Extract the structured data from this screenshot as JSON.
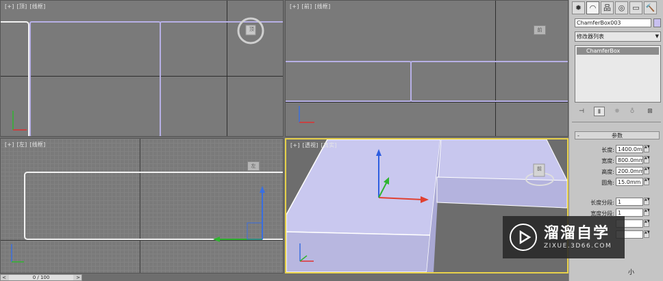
{
  "viewports": {
    "top": {
      "labels": [
        "[+]",
        "[顶]",
        "[线框]"
      ]
    },
    "front": {
      "labels": [
        "[+]",
        "[前]",
        "[线框]"
      ]
    },
    "left": {
      "labels": [
        "[+]",
        "[左]",
        "[线框]"
      ]
    },
    "perspective": {
      "labels": [
        "[+]",
        "[透视]",
        "[真实]"
      ]
    },
    "viewcube": {
      "top_face": "顶",
      "front_face": "前",
      "left_face": "左",
      "persp_face": "前"
    }
  },
  "command_panel": {
    "tabs": [
      {
        "icon": "create-icon",
        "glyph": "✹"
      },
      {
        "icon": "modify-icon",
        "glyph": "◠"
      },
      {
        "icon": "hierarchy-icon",
        "glyph": "品"
      },
      {
        "icon": "motion-icon",
        "glyph": "◎"
      },
      {
        "icon": "display-icon",
        "glyph": "▭"
      },
      {
        "icon": "utilities-icon",
        "glyph": "🔨"
      }
    ],
    "object_name": "ChamferBox003",
    "object_color": "#c8c0f0",
    "modifier_list": "修改器列表",
    "stack_item": "ChamferBox",
    "params_header": "参数",
    "params": [
      {
        "label": "长度:",
        "value": "1400.0mm"
      },
      {
        "label": "宽度:",
        "value": "800.0mm"
      },
      {
        "label": "高度:",
        "value": "200.0mm"
      },
      {
        "label": "圆角:",
        "value": "15.0mm"
      }
    ],
    "segments": [
      {
        "label": "长度分段:",
        "value": "1"
      },
      {
        "label": "宽度分段:",
        "value": "1"
      },
      {
        "label": "",
        "value": ""
      },
      {
        "label": "",
        "value": ""
      }
    ],
    "bottom_text": "小"
  },
  "time_slider": {
    "value": "0 / 100",
    "left": "<",
    "right": ">"
  },
  "watermark": {
    "title": "溜溜自学",
    "subtitle": "ZIXUE.3D66.COM"
  },
  "colors": {
    "accent_active": "#e8d24a",
    "selection_outline": "#b7b0e6"
  }
}
